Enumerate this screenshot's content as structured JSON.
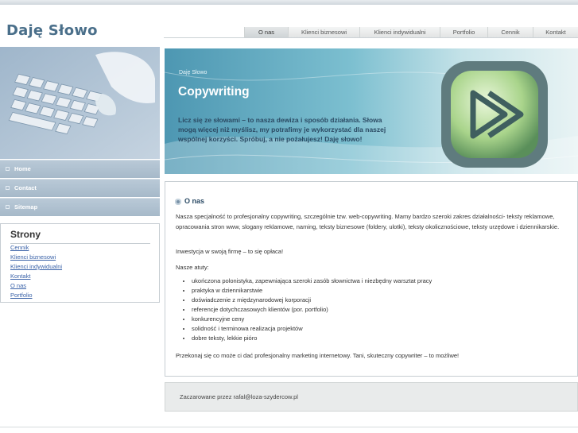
{
  "site": {
    "title": "Daję Słowo"
  },
  "tabs": [
    {
      "label": "O nas",
      "active": true
    },
    {
      "label": "Klienci biznesowi"
    },
    {
      "label": "Klienci indywidualni"
    },
    {
      "label": "Portfolio"
    },
    {
      "label": "Cennik"
    },
    {
      "label": "Kontakt"
    }
  ],
  "sidebar": {
    "nav": [
      "Home",
      "Contact",
      "Sitemap"
    ],
    "box": {
      "title": "Strony",
      "links": [
        "Cennik",
        "Klienci biznesowi",
        "Klienci indywidualni",
        "Kontakt",
        "O nas",
        "Portfolio"
      ]
    }
  },
  "banner": {
    "small": "Daję Słowo",
    "title": "Copywriting",
    "slogan": "Licz się ze słowami – to nasza dewiza i sposób działania. Słowa mogą więcej niż myślisz, my potrafimy je wykorzystać dla naszej wspólnej korzyści. Spróbuj, a nie pożałujesz! Daję słowo!"
  },
  "content": {
    "heading": "O nas",
    "p1": "Nasza specjalność to profesjonalny copywriting, szczególnie tzw. web-copywriting. Mamy bardzo szeroki zakres działalności- teksty reklamowe, opracowania stron www, slogany reklamowe, naming, teksty biznesowe (foldery, ulotki), teksty okolicznościowe, teksty urzędowe i dziennikarskie.",
    "p2": "Inwestycja w swoją firmę – to się opłaca!",
    "p3": "Nasze atuty:",
    "list": [
      "ukończona polonistyka, zapewniająca szeroki zasób słownictwa i niezbędny warsztat pracy",
      "praktyka w dziennikarstwie",
      "doświadczenie z międzynarodowej korporacji",
      "referencje dotychczasowych klientów (por. portfolio)",
      "konkurencyjne ceny",
      "solidność i terminowa realizacja projektów",
      "dobre teksty, lekkie pióro"
    ],
    "p4": "Przekonaj się co może ci dać profesjonalny marketing internetowy. Tani, skuteczny copywriter – to możliwe!"
  },
  "footer": {
    "text": "Zaczarowane przez rafal@loza-szydercow.pl"
  },
  "colors": {
    "brand": "#4a6f8a",
    "nav": "#a6b9c9",
    "link": "#3a62a8"
  }
}
